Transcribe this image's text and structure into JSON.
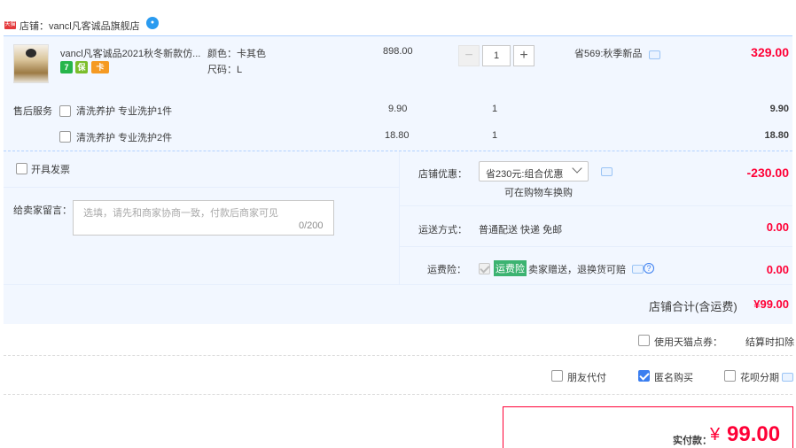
{
  "store": {
    "badge": "天猫",
    "name": "店铺：vancl凡客诚品旗舰店",
    "ww_icon": "chat-bubble-icon"
  },
  "product": {
    "title": "vancl凡客诚品2021秋冬新款仿...",
    "color": "颜色：卡其色",
    "size": "尺码：L",
    "unit_price": "898.00",
    "quantity": "1",
    "minus": "−",
    "plus": "+",
    "promo": "省569:秋季新品",
    "line_total": "329.00",
    "service_icons": [
      "7",
      "保",
      "卡"
    ]
  },
  "after_sales": {
    "label": "售后服务",
    "items": [
      {
        "name": "清洗养护 专业洗护1件",
        "price": "9.90",
        "qty": "1",
        "total": "9.90",
        "checked": false
      },
      {
        "name": "清洗养护 专业洗护2件",
        "price": "18.80",
        "qty": "1",
        "total": "18.80",
        "checked": false
      }
    ]
  },
  "invoice": {
    "label": "开具发票",
    "checked": false
  },
  "memo": {
    "label": "给卖家留言：",
    "placeholder": "选填，请先和商家协商一致，付款后商家可见",
    "count": "0/200"
  },
  "coupon": {
    "label": "店铺优惠：",
    "selected": "省230元:组合优惠",
    "note": "可在购物车换购",
    "amount": "-230.00"
  },
  "shipping": {
    "label": "运送方式：",
    "method": "普通配送 快递 免邮",
    "amount": "0.00"
  },
  "insurance": {
    "label": "运费险：",
    "badge": "运费险",
    "desc": "卖家赠送，退换货可赔",
    "help": "?",
    "amount": "0.00"
  },
  "store_total": {
    "label": "店铺合计(含运费)",
    "amount": "¥99.00"
  },
  "points": {
    "label": "使用天猫点券：",
    "note": "结算时扣除",
    "checked": false
  },
  "options": {
    "friend_pay": {
      "label": "朋友代付",
      "checked": false
    },
    "anonymous": {
      "label": "匿名购买",
      "checked": true
    },
    "huabei": {
      "label": "花呗分期",
      "checked": false
    }
  },
  "pay": {
    "label": "实付款：",
    "currency": "¥",
    "amount": "99.00"
  },
  "colors": {
    "accent_red": "#ff0036",
    "panel_blue": "#f2f7ff",
    "checkbox_blue": "#3a7ef0"
  }
}
